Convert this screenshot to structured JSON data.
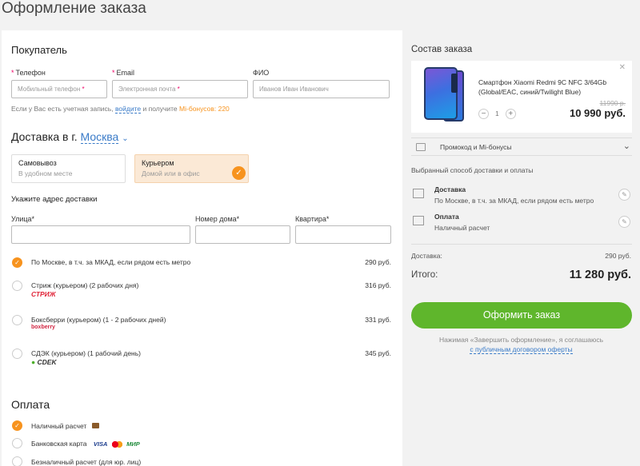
{
  "page_title": "Оформление заказа",
  "buyer": {
    "title": "Покупатель",
    "phone_label": "Телефон",
    "phone_placeholder": "Мобильный телефон",
    "email_label": "Email",
    "email_placeholder": "Электронная почта",
    "fio_label": "ФИО",
    "fio_placeholder": "Иванов Иван Иванович",
    "note_pre": "Если у Вас есть учетная запись,",
    "note_link": "войдите",
    "note_mid": "и получите",
    "note_bonus": "Mi-бонусов: 220"
  },
  "delivery": {
    "title_prefix": "Доставка в г.",
    "city": "Москва",
    "options": [
      {
        "title": "Самовывоз",
        "subtitle": "В удобном месте"
      },
      {
        "title": "Курьером",
        "subtitle": "Домой или в офис"
      }
    ],
    "address_title": "Укажите адрес доставки",
    "street_label": "Улица*",
    "house_label": "Номер дома*",
    "apt_label": "Квартира*",
    "methods": [
      {
        "name": "По Москве, в т.ч. за МКАД, если рядом есть метро",
        "price": "290 руб.",
        "logo": ""
      },
      {
        "name": "Стриж (курьером) (2 рабочих дня)",
        "price": "316 руб.",
        "logo": "СТРИЖ"
      },
      {
        "name": "Боксберри (курьером) (1 - 2 рабочих дней)",
        "price": "331 руб.",
        "logo": "boxberry"
      },
      {
        "name": "СДЭК (курьером) (1 рабочий день)",
        "price": "345 руб.",
        "logo": "CDEK"
      }
    ]
  },
  "payment": {
    "title": "Оплата",
    "methods": [
      "Наличный расчет",
      "Банковская карта",
      "Безналичный расчет (для юр. лиц)"
    ],
    "cards": [
      "VISA",
      "МИР"
    ]
  },
  "order": {
    "title": "Состав заказа",
    "product_name": "Смартфон Xiaomi Redmi 9C NFC 3/64Gb (Global/EAC, синий/Twilight Blue)",
    "quantity": "1",
    "old_price": "11990 р.",
    "price": "10 990 руб.",
    "promo": "Промокод и Mi-бонусы",
    "chosen_title": "Выбранный способ доставки и оплаты",
    "ship_title": "Доставка",
    "ship_desc": "По Москве, в т.ч. за МКАД, если рядом есть метро",
    "pay_title": "Оплата",
    "pay_desc": "Наличный расчет",
    "delivery_label": "Доставка:",
    "delivery_cost": "290 руб.",
    "total_label": "Итого:",
    "total": "11 280 руб.",
    "submit": "Оформить заказ",
    "agree_text": "Нажимая «Завершить оформление», я соглашаюсь",
    "agree_link": "с публичным договором оферты"
  },
  "colors": {
    "accent": "#f7931e",
    "button": "#5fb62c",
    "link": "#3a7bc8"
  }
}
